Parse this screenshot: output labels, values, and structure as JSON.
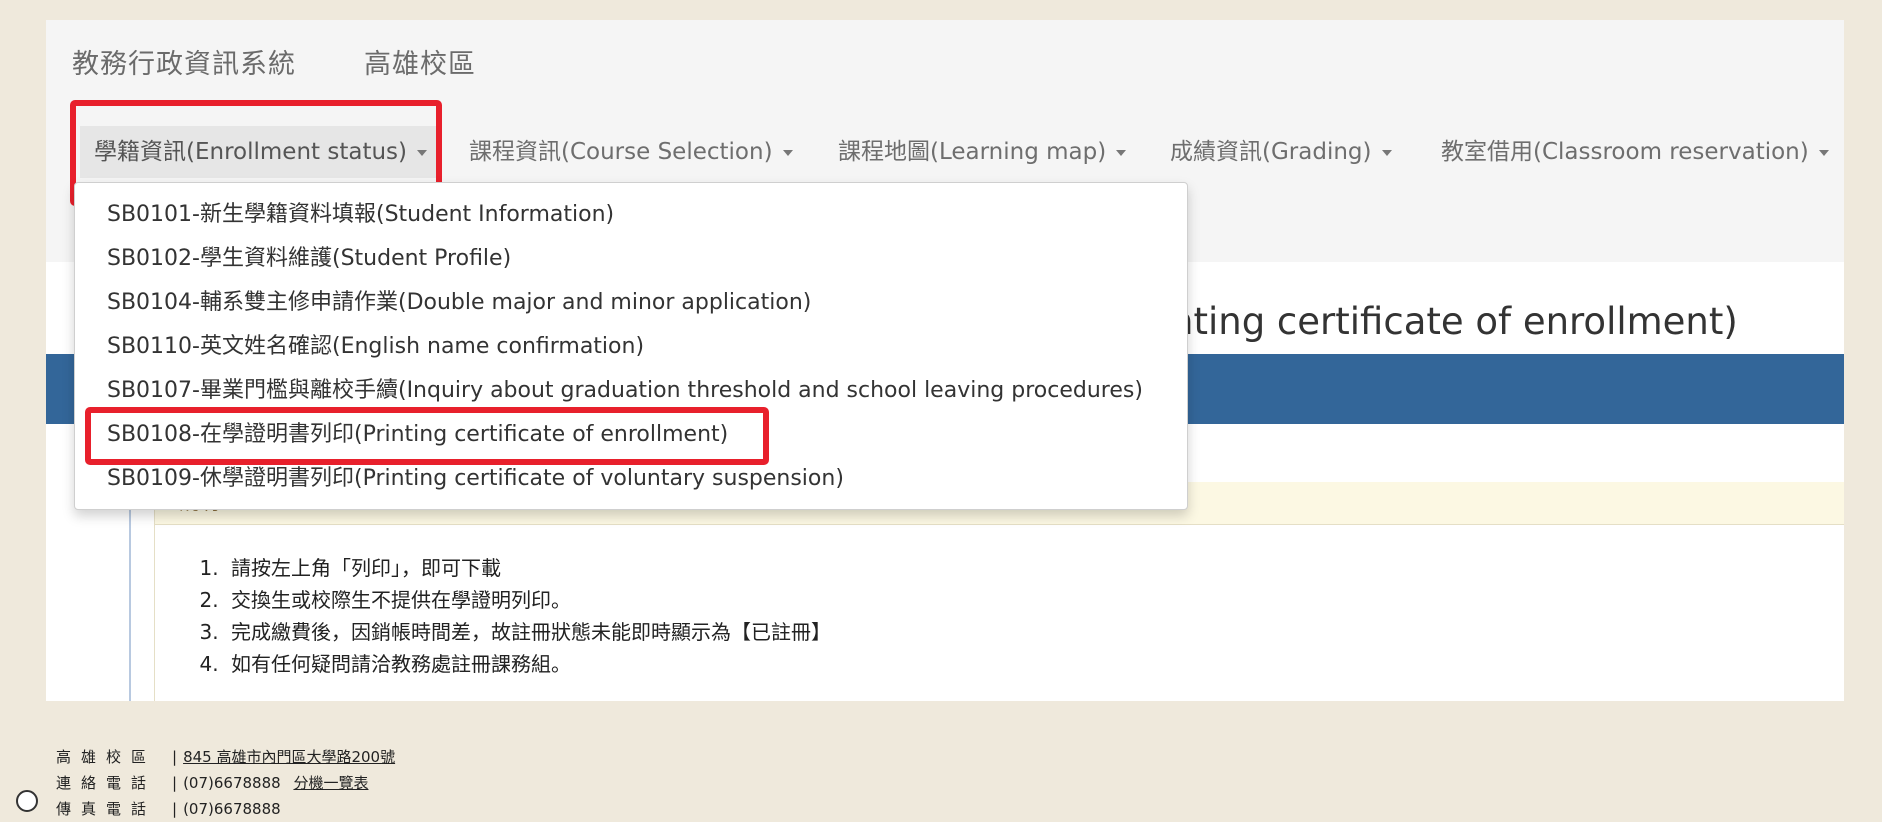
{
  "header": {
    "system_name": "教務行政資訊系統",
    "campus": "高雄校區"
  },
  "nav": {
    "items": [
      {
        "label": "學籍資訊(Enrollment status)",
        "active": true
      },
      {
        "label": "課程資訊(Course Selection)"
      },
      {
        "label": "課程地圖(Learning map)"
      },
      {
        "label": "成績資訊(Grading)"
      },
      {
        "label": "教室借用(Classroom reservation)"
      }
    ]
  },
  "dropdown": {
    "items": [
      {
        "label": "SB0101-新生學籍資料填報(Student Information)"
      },
      {
        "label": "SB0102-學生資料維護(Student Profile)"
      },
      {
        "label": "SB0104-輔系雙主修申請作業(Double major and minor application)"
      },
      {
        "label": "SB0110-英文姓名確認(English name confirmation)"
      },
      {
        "label": "SB0107-畢業門檻與離校手續(Inquiry about graduation threshold and school leaving procedures)"
      },
      {
        "label": "SB0108-在學證明書列印(Printing certificate of enrollment)",
        "highlighted": true
      },
      {
        "label": "SB0109-休學證明書列印(Printing certificate of voluntary suspension)"
      }
    ]
  },
  "page": {
    "title_visible": "nting certificate of enrollment)",
    "panel_heading": "說明"
  },
  "notes": [
    "請按左上角「列印」，即可下載",
    "交換生或校際生不提供在學證明列印。",
    "完成繳費後，因銷帳時間差，故註冊狀態未能即時顯示為【已註冊】",
    "如有任何疑問請洽教務處註冊課務組。"
  ],
  "footer": {
    "address_label": "高雄校區",
    "address": "845 高雄市內門區大學路200號",
    "phone_label": "連絡電話",
    "phone": "(07)6678888",
    "extension_link": "分機一覽表",
    "fax_label": "傳真電話",
    "fax": "(07)6678888"
  },
  "colors": {
    "highlight": "#e8202c",
    "title_bar": "#336699",
    "background": "#efe9dc",
    "panel_heading_bg": "#fcf8e3"
  },
  "icons": [
    "caret-down-icon",
    "accessibility-icon"
  ]
}
